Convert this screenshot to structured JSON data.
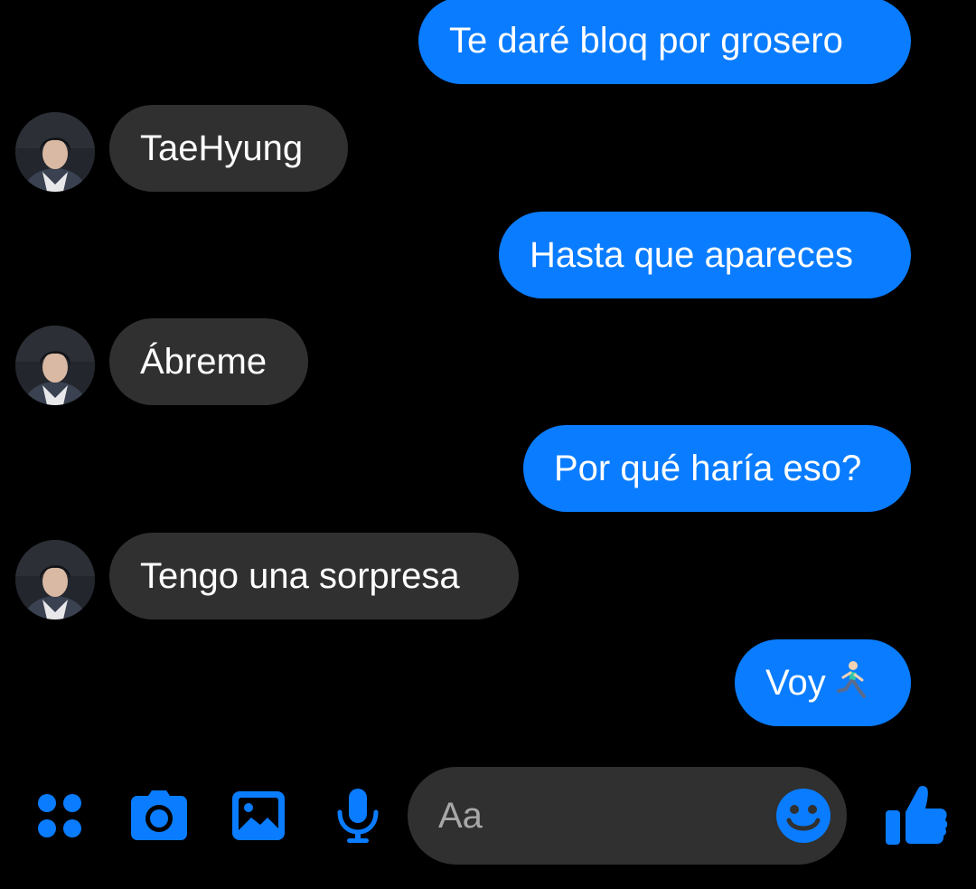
{
  "conversation": {
    "contact_avatar_alt": "TaeHyung avatar",
    "messages": [
      {
        "direction": "outgoing",
        "text": "Te daré bloq por grosero"
      },
      {
        "direction": "incoming",
        "text": "TaeHyung"
      },
      {
        "direction": "outgoing",
        "text": "Hasta que apareces"
      },
      {
        "direction": "incoming",
        "text": "Ábreme"
      },
      {
        "direction": "outgoing",
        "text": "Por qué haría eso?"
      },
      {
        "direction": "incoming",
        "text": "Tengo una sorpresa"
      },
      {
        "direction": "outgoing",
        "text": "Voy",
        "emoji": "running-man"
      }
    ]
  },
  "composer": {
    "input_placeholder": "Aa",
    "icons": [
      "menu-dots-icon",
      "camera-icon",
      "gallery-icon",
      "microphone-icon",
      "emoji-icon",
      "thumbs-up-icon"
    ]
  },
  "colors": {
    "background": "#000000",
    "outgoing_bubble": "#0a7cff",
    "incoming_bubble": "#303030",
    "accent": "#0a7cff",
    "input_background": "#303030",
    "placeholder_text": "#a8a8a8"
  }
}
